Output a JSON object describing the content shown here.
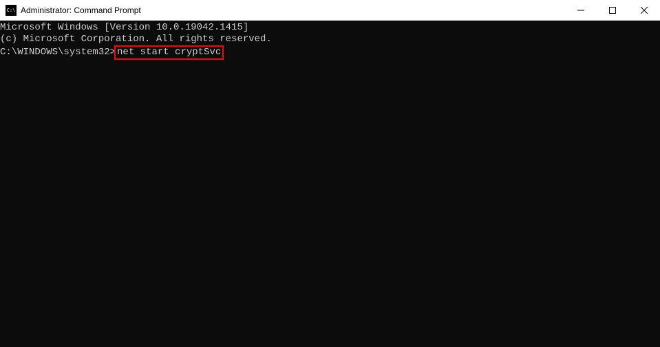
{
  "titlebar": {
    "icon_text": "C:\\",
    "title": "Administrator: Command Prompt"
  },
  "terminal": {
    "line1": "Microsoft Windows [Version 10.0.19042.1415]",
    "line2": "(c) Microsoft Corporation. All rights reserved.",
    "blank": "",
    "prompt": "C:\\WINDOWS\\system32>",
    "command": "net start cryptSvc"
  }
}
